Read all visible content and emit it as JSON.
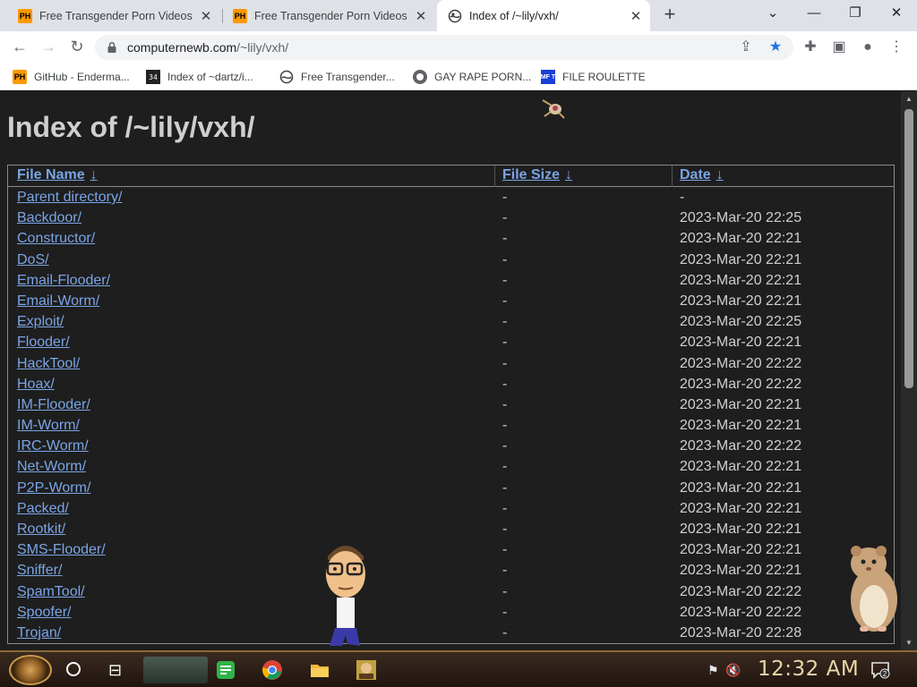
{
  "browser": {
    "tabs": [
      {
        "title": "Free Transgender Porn Videos",
        "favicon": "ph-icon",
        "active": false
      },
      {
        "title": "Free Transgender Porn Videos",
        "favicon": "ph-icon",
        "active": false
      },
      {
        "title": "Index of /~lily/vxh/",
        "favicon": "globe-icon",
        "active": true
      }
    ],
    "ph_badge": "PH",
    "newtab_glyph": "+",
    "url_host": "computernewb.com",
    "url_path": "/~lily/vxh/",
    "bookmarks": [
      {
        "label": "GitHub - Enderma...",
        "icon": "ph-icon"
      },
      {
        "label": "Index of ~dartz/i...",
        "icon": "dartz-icon"
      },
      {
        "label": "Free Transgender...",
        "icon": "globe-icon"
      },
      {
        "label": "GAY RAPE PORN...",
        "icon": "globe-icon"
      },
      {
        "label": "FILE ROULETTE",
        "icon": "file-roulette-icon"
      }
    ],
    "dartz_glyph": "34",
    "ft_glyph": "MF T"
  },
  "page": {
    "heading": "Index of /~lily/vxh/",
    "columns": {
      "name": "File Name",
      "size": "File Size",
      "date": "Date",
      "sort_arrow": "↓"
    },
    "rows": [
      {
        "name": "Parent directory/",
        "size": "-",
        "date": "-"
      },
      {
        "name": "Backdoor/",
        "size": "-",
        "date": "2023-Mar-20 22:25"
      },
      {
        "name": "Constructor/",
        "size": "-",
        "date": "2023-Mar-20 22:21"
      },
      {
        "name": "DoS/",
        "size": "-",
        "date": "2023-Mar-20 22:21"
      },
      {
        "name": "Email-Flooder/",
        "size": "-",
        "date": "2023-Mar-20 22:21"
      },
      {
        "name": "Email-Worm/",
        "size": "-",
        "date": "2023-Mar-20 22:21"
      },
      {
        "name": "Exploit/",
        "size": "-",
        "date": "2023-Mar-20 22:25"
      },
      {
        "name": "Flooder/",
        "size": "-",
        "date": "2023-Mar-20 22:21"
      },
      {
        "name": "HackTool/",
        "size": "-",
        "date": "2023-Mar-20 22:22"
      },
      {
        "name": "Hoax/",
        "size": "-",
        "date": "2023-Mar-20 22:22"
      },
      {
        "name": "IM-Flooder/",
        "size": "-",
        "date": "2023-Mar-20 22:21"
      },
      {
        "name": "IM-Worm/",
        "size": "-",
        "date": "2023-Mar-20 22:21"
      },
      {
        "name": "IRC-Worm/",
        "size": "-",
        "date": "2023-Mar-20 22:22"
      },
      {
        "name": "Net-Worm/",
        "size": "-",
        "date": "2023-Mar-20 22:21"
      },
      {
        "name": "P2P-Worm/",
        "size": "-",
        "date": "2023-Mar-20 22:21"
      },
      {
        "name": "Packed/",
        "size": "-",
        "date": "2023-Mar-20 22:21"
      },
      {
        "name": "Rootkit/",
        "size": "-",
        "date": "2023-Mar-20 22:21"
      },
      {
        "name": "SMS-Flooder/",
        "size": "-",
        "date": "2023-Mar-20 22:21"
      },
      {
        "name": "Sniffer/",
        "size": "-",
        "date": "2023-Mar-20 22:21"
      },
      {
        "name": "SpamTool/",
        "size": "-",
        "date": "2023-Mar-20 22:22"
      },
      {
        "name": "Spoofer/",
        "size": "-",
        "date": "2023-Mar-20 22:22"
      },
      {
        "name": "Trojan/",
        "size": "-",
        "date": "2023-Mar-20 22:28"
      }
    ]
  },
  "taskbar": {
    "clock": "12:32 AM",
    "notification_count": "2",
    "pinned": [
      "cortana-icon",
      "task-view-icon",
      "notes-icon",
      "chrome-icon",
      "folder-icon",
      "app-icon"
    ]
  },
  "colors": {
    "page_bg": "#1e1e1e",
    "link": "#7aa5e6",
    "text": "#cfcfcf",
    "tab_strip": "#dee1e6",
    "bookmark_star": "#1a73e8"
  }
}
